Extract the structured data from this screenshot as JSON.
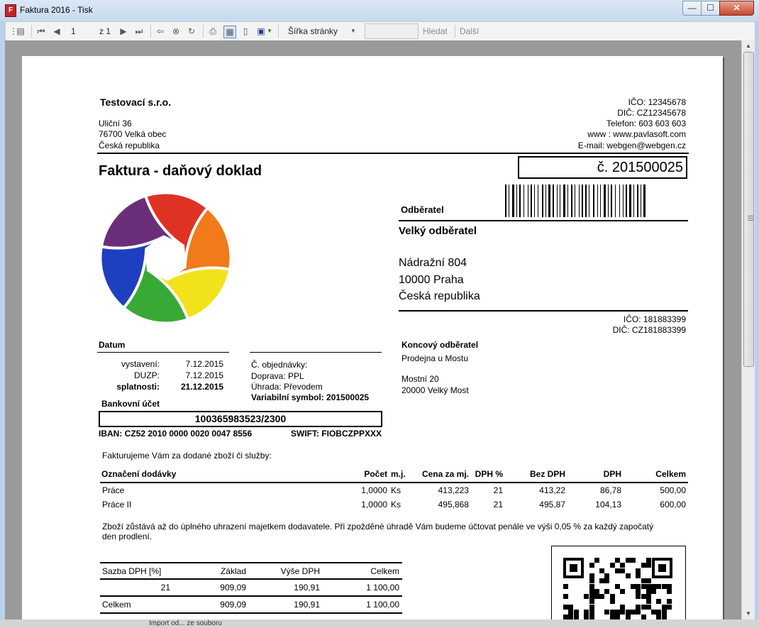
{
  "window": {
    "title": "Faktura 2016 - Tisk",
    "app_icon_glyph": "F",
    "minimize": "—",
    "maximize": "☐",
    "close": "✕"
  },
  "toolbar": {
    "page_current": "1",
    "page_total_label": "z 1",
    "zoom_select": "Šířka stránky",
    "search_value": "",
    "find_label": "Hledat",
    "next_label": "Další"
  },
  "bottom_strip": {
    "text": "Import od... ze souboru"
  },
  "invoice": {
    "company": {
      "name": "Testovací s.r.o.",
      "street": "Uliční 36",
      "city": "76700  Velká obec",
      "country": "Česká republika"
    },
    "company_contacts": [
      "IČO: 12345678",
      "DIČ: CZ12345678",
      "Telefon: 603 603 603",
      "www : www.pavlasoft.com",
      "E-mail: webgen@webgen.cz"
    ],
    "title": "Faktura - daňový doklad",
    "number": "č. 201500025",
    "customer_heading": "Odběratel",
    "customer": {
      "name": "Velký odběratel",
      "street": "Nádražní 804",
      "city": "10000  Praha",
      "country": "Česká republika",
      "ico": "IČO: 181883399",
      "dic": "DIČ: CZ181883399"
    },
    "final_customer": {
      "heading": "Koncový odběratel",
      "name": "Prodejna u Mostu",
      "street": "Mostní 20",
      "city": "20000  Velký Most"
    },
    "dates": {
      "heading": "Datum",
      "issued_label": "vystavení:",
      "issued": "7.12.2015",
      "duzp_label": "DUZP:",
      "duzp": "7.12.2015",
      "due_label": "splatnosti:",
      "due": "21.12.2015"
    },
    "order": {
      "order_no": "Č. objednávky:",
      "transport": "Doprava: PPL",
      "payment": "Úhrada: Převodem",
      "varsym": "Variabilní symbol: 201500025"
    },
    "bank": {
      "heading": "Bankovní účet",
      "account": "100365983523/2300",
      "iban": "IBAN: CZ52 2010 0000 0020 0047 8556",
      "swift": "SWIFT: FIOBCZPPXXX"
    },
    "intro": "Fakturujeme Vám za dodané zboží či služby:",
    "items_headers": [
      "Označení dodávky",
      "Počet",
      "m.j.",
      "Cena za mj.",
      "DPH %",
      "Bez DPH",
      "DPH",
      "Celkem"
    ],
    "items": [
      [
        "Práce",
        "1,0000",
        "Ks",
        "413,223",
        "21",
        "413,22",
        "86,78",
        "500,00"
      ],
      [
        "Práce II",
        "1,0000",
        "Ks",
        "495,868",
        "21",
        "495,87",
        "104,13",
        "600,00"
      ]
    ],
    "note_line1": "Zboží zůstává až do úplného uhrazení majetkem dodavatele. Při zpožděné úhradě Vám budeme účtovat penále ve výši 0,05 % za každý započatý",
    "note_line2": "den prodlení.",
    "vat_headers": [
      "Sazba DPH [%]",
      "Základ",
      "Výše DPH",
      "Celkem"
    ],
    "vat_rows": [
      [
        "21",
        "909,09",
        "190,91",
        "1 100,00"
      ]
    ],
    "vat_total": [
      "Celkem",
      "909,09",
      "190,91",
      "1 100,00"
    ]
  },
  "colors": {
    "logo": [
      "#e03224",
      "#f17a1a",
      "#f2e21c",
      "#39a935",
      "#1e3fbf",
      "#6b2f7a"
    ]
  }
}
